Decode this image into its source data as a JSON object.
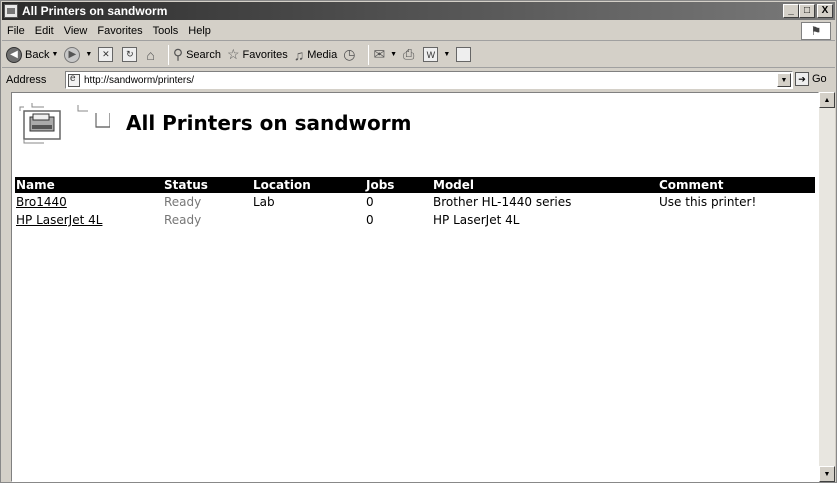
{
  "window": {
    "title": "All Printers on sandworm",
    "buttons": {
      "minimize": "_",
      "maximize": "□",
      "close": "X"
    }
  },
  "menu": [
    {
      "label": "File"
    },
    {
      "label": "Edit"
    },
    {
      "label": "View"
    },
    {
      "label": "Favorites"
    },
    {
      "label": "Tools"
    },
    {
      "label": "Help"
    }
  ],
  "toolbar": {
    "back": "Back",
    "search": "Search",
    "favorites": "Favorites",
    "media": "Media"
  },
  "address": {
    "label": "Address",
    "url": "http://sandworm/printers/",
    "go": "Go"
  },
  "page": {
    "heading": "All Printers on sandworm"
  },
  "table": {
    "headers": [
      "Name",
      "Status",
      "Location",
      "Jobs",
      "Model",
      "Comment"
    ],
    "rows": [
      {
        "name": "Bro1440",
        "status": "Ready",
        "location": "Lab",
        "jobs": "0",
        "model": "Brother HL-1440 series",
        "comment": "Use this printer!"
      },
      {
        "name": "HP LaserJet 4L",
        "status": "Ready",
        "location": "",
        "jobs": "0",
        "model": "HP LaserJet 4L",
        "comment": ""
      }
    ]
  }
}
